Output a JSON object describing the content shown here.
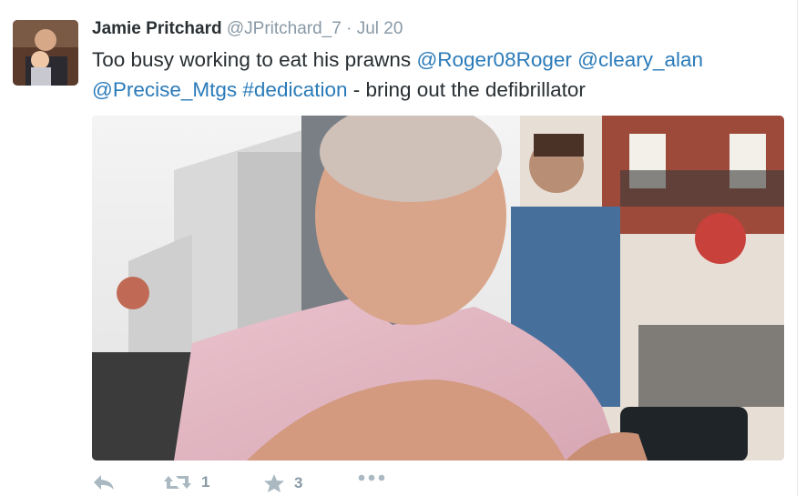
{
  "tweet": {
    "fullname": "Jamie Pritchard",
    "username": "@JPritchard_7",
    "separator": "·",
    "time": "Jul 20",
    "text": {
      "prefix": "Too busy working to eat his prawns ",
      "mention1": "@Roger08Roger",
      "space1": " ",
      "mention2": "@cleary_alan",
      "space2": " ",
      "mention3": "@Precise_Mtgs",
      "space3": " ",
      "hashtag": "#dedication",
      "suffix": " - bring out the defibrillator"
    }
  },
  "actions": {
    "reply_icon": "reply-icon",
    "retweet_icon": "retweet-icon",
    "retweet_count": "1",
    "favorite_icon": "star-icon",
    "favorite_count": "3",
    "more_icon": "more-icon"
  },
  "colors": {
    "text": "#292f33",
    "muted": "#8899a6",
    "link": "#2b7bb9"
  }
}
